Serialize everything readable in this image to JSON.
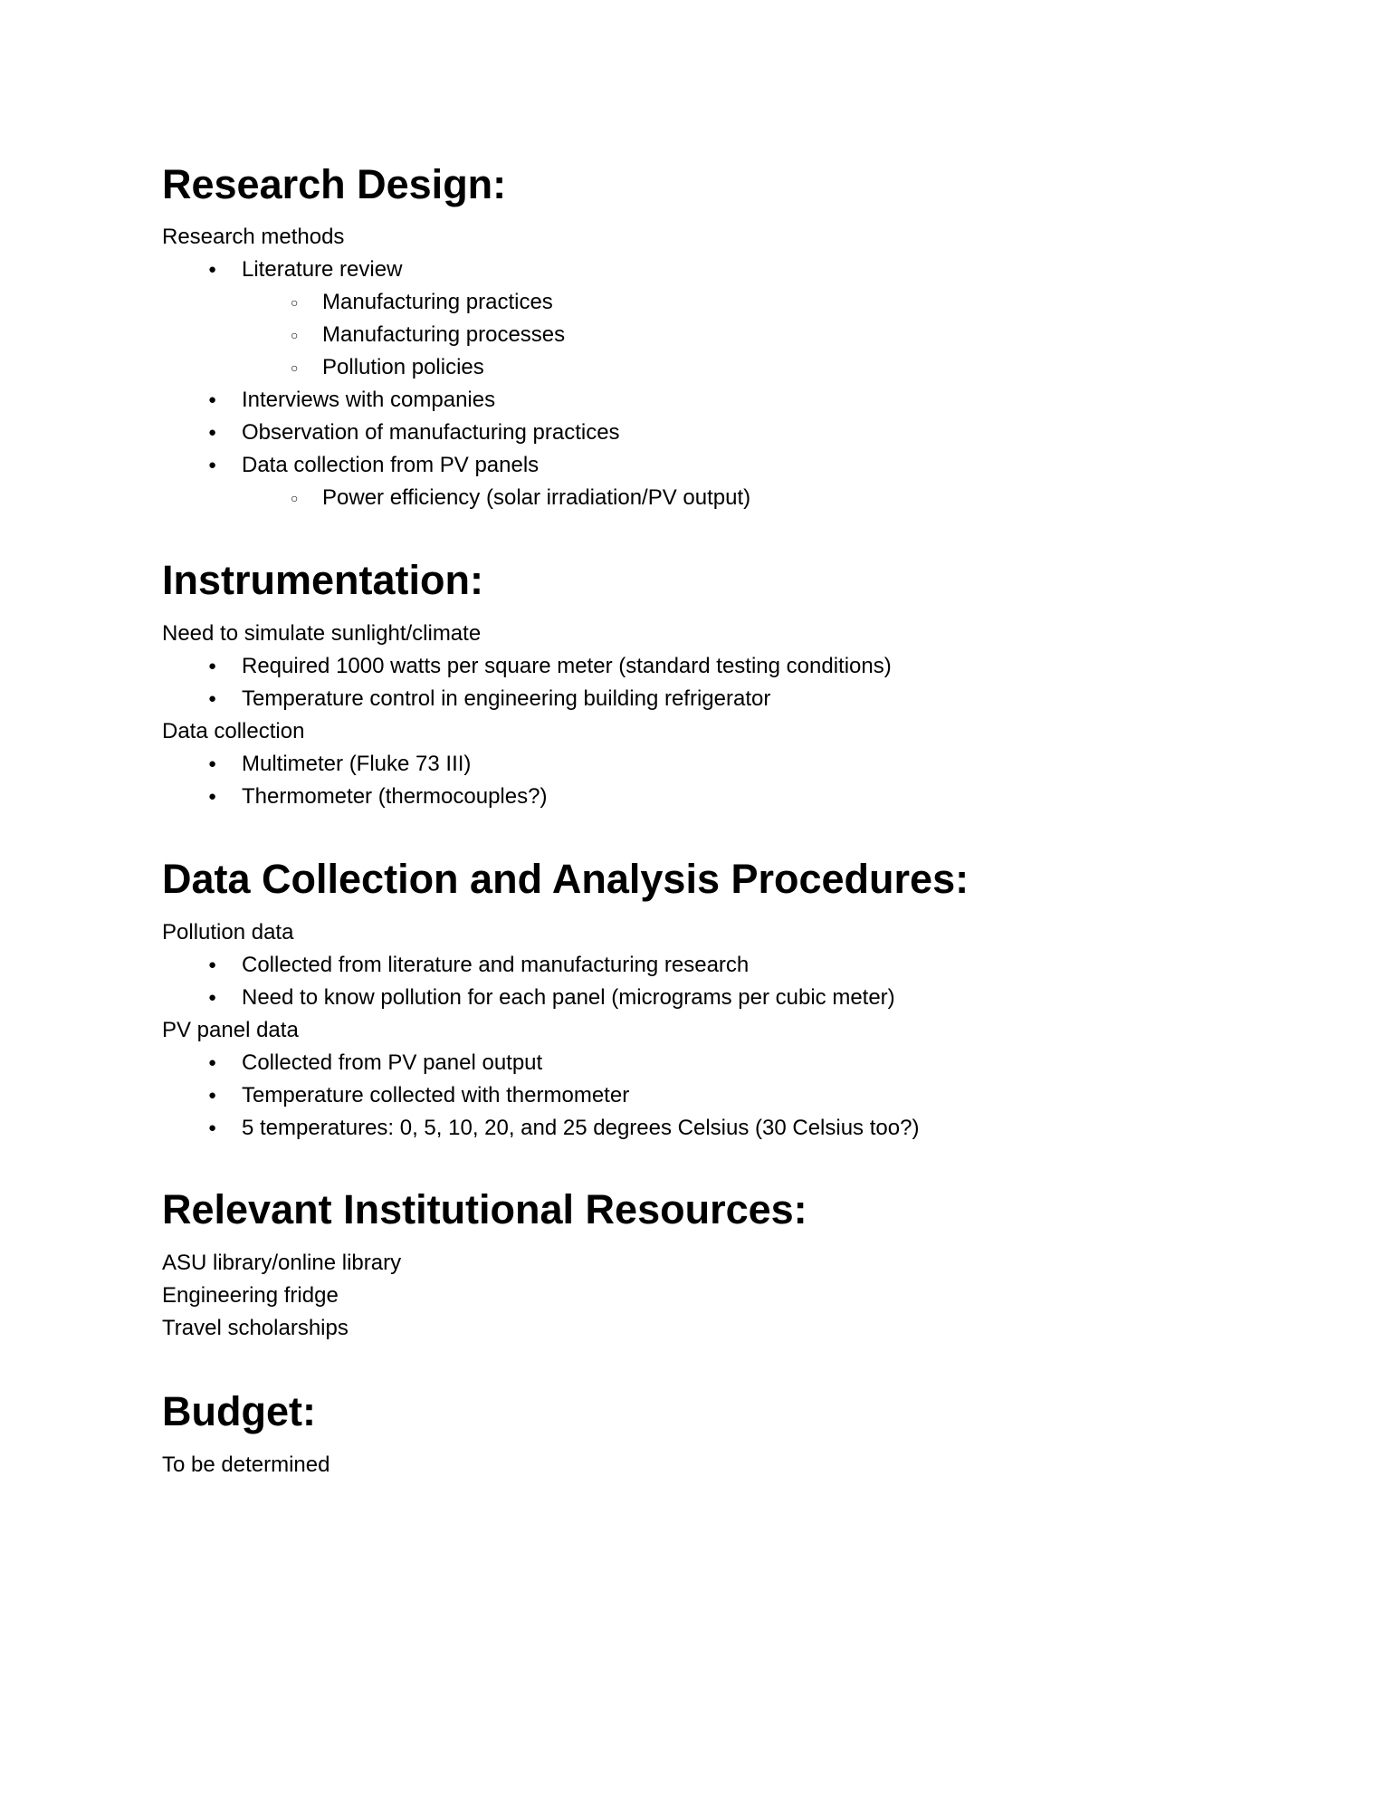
{
  "sections": [
    {
      "heading": "Research Design:",
      "lines": [
        {
          "level": 0,
          "text": "Research methods"
        },
        {
          "level": 1,
          "text": "Literature review"
        },
        {
          "level": 2,
          "text": "Manufacturing practices"
        },
        {
          "level": 2,
          "text": "Manufacturing processes"
        },
        {
          "level": 2,
          "text": "Pollution policies"
        },
        {
          "level": 1,
          "text": "Interviews with companies"
        },
        {
          "level": 1,
          "text": "Observation of manufacturing practices"
        },
        {
          "level": 1,
          "text": "Data collection from PV panels"
        },
        {
          "level": 2,
          "text": "Power efficiency (solar irradiation/PV output)"
        }
      ]
    },
    {
      "heading": "Instrumentation:",
      "lines": [
        {
          "level": 0,
          "text": "Need to simulate sunlight/climate"
        },
        {
          "level": 1,
          "text": "Required 1000 watts per square meter (standard testing conditions)"
        },
        {
          "level": 1,
          "text": "Temperature control in engineering building refrigerator"
        },
        {
          "level": 0,
          "text": "Data collection"
        },
        {
          "level": 1,
          "text": "Multimeter (Fluke 73 III)"
        },
        {
          "level": 1,
          "text": "Thermometer (thermocouples?)"
        }
      ]
    },
    {
      "heading": "Data Collection and Analysis Procedures:",
      "lines": [
        {
          "level": 0,
          "text": "Pollution data"
        },
        {
          "level": 1,
          "text": "Collected from literature and manufacturing research"
        },
        {
          "level": 1,
          "text": "Need to know pollution for each panel (micrograms per cubic meter)"
        },
        {
          "level": 0,
          "text": "PV panel data"
        },
        {
          "level": 1,
          "text": "Collected from PV panel output"
        },
        {
          "level": 1,
          "text": "Temperature collected with thermometer"
        },
        {
          "level": 1,
          "text": "5 temperatures: 0, 5, 10, 20, and 25 degrees Celsius (30 Celsius too?)"
        }
      ]
    },
    {
      "heading": "Relevant Institutional Resources:",
      "lines": [
        {
          "level": 0,
          "text": "ASU library/online library"
        },
        {
          "level": 0,
          "text": "Engineering fridge"
        },
        {
          "level": 0,
          "text": "Travel scholarships"
        }
      ]
    },
    {
      "heading": "Budget:",
      "lines": [
        {
          "level": 0,
          "text": "To be determined"
        }
      ]
    }
  ]
}
